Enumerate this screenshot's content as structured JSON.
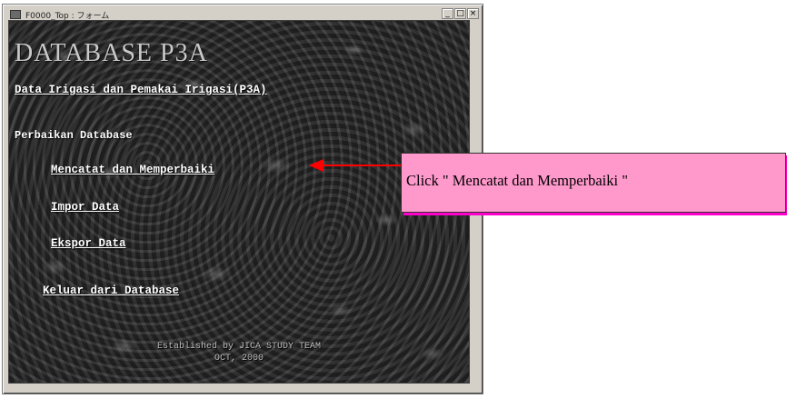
{
  "window": {
    "title": "F0000_Top : フォーム",
    "minimize_symbol": "_",
    "maximize_symbol": "□",
    "close_symbol": "×"
  },
  "form": {
    "title": "DATABASE P3A",
    "data_link": "Data Irigasi dan Pemakai Irigasi(P3A)",
    "section_label": "Perbaikan Database",
    "items": [
      {
        "label": "Mencatat dan Memperbaiki"
      },
      {
        "label": "Impor Data"
      },
      {
        "label": "Ekspor Data"
      }
    ],
    "exit_link": "Keluar dari Database",
    "footer_line1": "Established by JICA STUDY TEAM",
    "footer_line2": "OCT, 2000"
  },
  "annotation": {
    "text": "Click \" Mencatat dan Memperbaiki \"",
    "arrow_color": "#ff0000",
    "box_color": "#ff99cc",
    "shadow_color": "#ff00cc"
  },
  "icons": {
    "app": "form-window-icon",
    "arrow": "red-arrow-left"
  }
}
